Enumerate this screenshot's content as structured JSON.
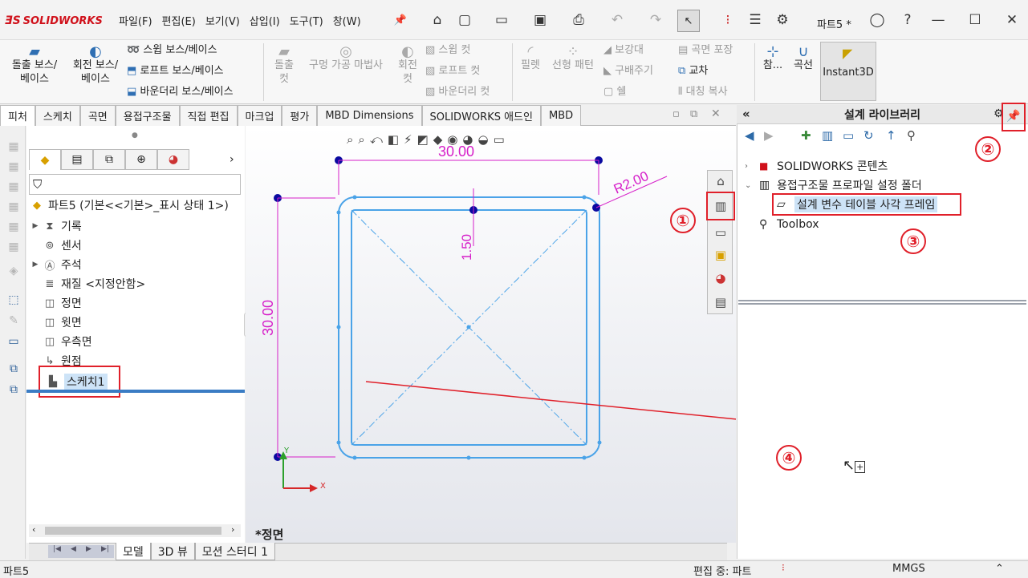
{
  "window": {
    "app": "SOLIDWORKS",
    "doc_title": "파트5 *"
  },
  "menu": [
    "파일(F)",
    "편집(E)",
    "보기(V)",
    "삽입(I)",
    "도구(T)",
    "창(W)"
  ],
  "ribbon": {
    "extrude_boss": "돌출 보스/\n베이스",
    "revolve_boss": "회전 보스/\n베이스",
    "swept_boss": "스윕 보스/베이스",
    "loft_boss": "로프트 보스/베이스",
    "boundary_boss": "바운더리 보스/베이스",
    "extrude_cut": "돌출\n컷",
    "hole_wizard": "구멍 가공 마법사",
    "revolve_cut": "회전\n컷",
    "swept_cut": "스윕 컷",
    "loft_cut": "로프트 컷",
    "boundary_cut": "바운더리 컷",
    "fillet": "필렛",
    "linear_pattern": "선형 패턴",
    "rib": "보강대",
    "draft": "구배주기",
    "shell": "쉘",
    "wrap": "곡면 포장",
    "intersect": "교차",
    "mirror": "대칭 복사",
    "reference": "참...",
    "curves": "곡선",
    "instant3d": "Instant3D"
  },
  "tabs": [
    "피처",
    "스케치",
    "곡면",
    "용접구조물",
    "직접 편집",
    "마크업",
    "평가",
    "MBD Dimensions",
    "SOLIDWORKS 애드인",
    "MBD"
  ],
  "feature_tree": {
    "root": "파트5  (기본<<기본>_표시 상태 1>)",
    "items": [
      "기록",
      "센서",
      "주석",
      "재질 <지정안함>",
      "정면",
      "윗면",
      "우측면",
      "원점",
      "스케치1"
    ]
  },
  "viewport": {
    "view_label": "*정면",
    "dim_top": "30.00",
    "dim_left": "30.00",
    "dim_thk": "1.50",
    "dim_radius": "R2.00",
    "axis_x": "X",
    "axis_y": "Y"
  },
  "design_library": {
    "title": "설계 라이브러리",
    "items": [
      "SOLIDWORKS 콘텐츠",
      "용접구조물 프로파일 설정 폴더",
      "설계 변수 테이블 사각 프레임",
      "Toolbox"
    ]
  },
  "callouts": [
    "①",
    "②",
    "③",
    "④"
  ],
  "bottom_tabs": [
    "모델",
    "3D 뷰",
    "모션 스터디 1"
  ],
  "status": {
    "left": "파트5",
    "mode": "편집 중: 파트",
    "units": "MMGS"
  },
  "colors": {
    "accent": "#e0202a",
    "sketch": "#4aa3e8",
    "dimension": "#d61fc9"
  }
}
